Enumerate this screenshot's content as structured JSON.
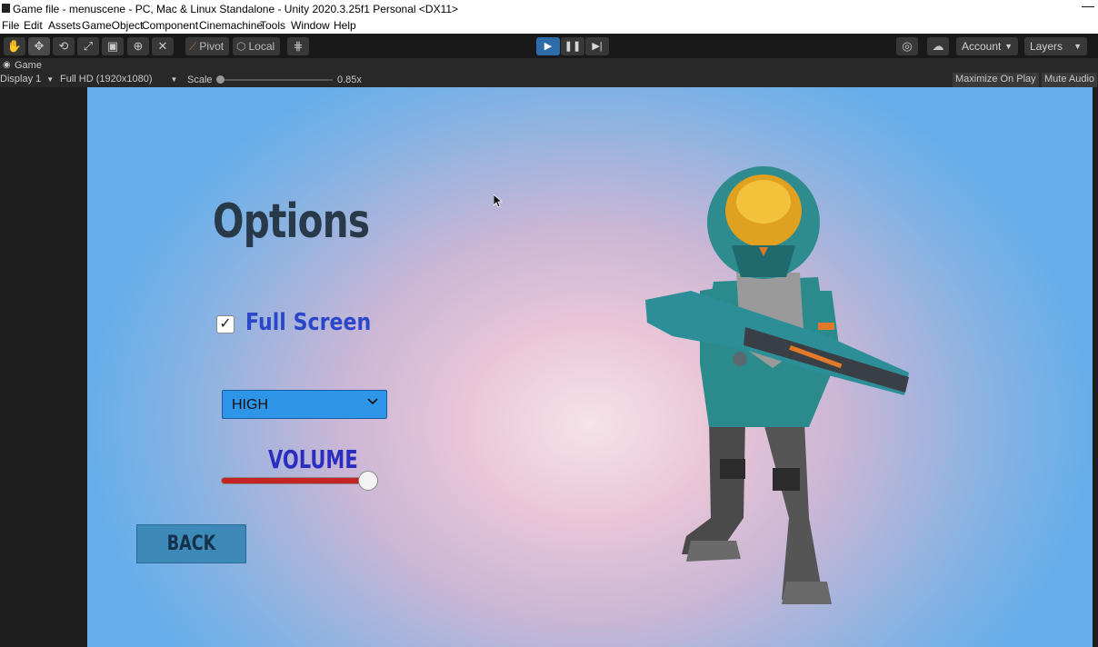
{
  "window": {
    "title": "Game file - menuscene - PC, Mac & Linux Standalone - Unity 2020.3.25f1 Personal <DX11>",
    "minimize_glyph": "—"
  },
  "menu": [
    "File",
    "Edit",
    "Assets",
    "GameObject",
    "Component",
    "Cinemachine",
    "Tools",
    "Window",
    "Help"
  ],
  "toolbar": {
    "pivot_label": "Pivot",
    "local_label": "Local",
    "account_label": "Account",
    "layers_label": "Layers"
  },
  "game_tab": {
    "label": "Game",
    "display": "Display 1",
    "resolution": "Full HD (1920x1080)",
    "scale_label": "Scale",
    "scale_value": "0.85x",
    "maximize_label": "Maximize On Play",
    "mute_label": "Mute Audio"
  },
  "game_ui": {
    "title": "Options",
    "fullscreen_label": "Full Screen",
    "fullscreen_checked": true,
    "quality_value": "HIGH",
    "volume_label": "VOLUME",
    "volume_level": 0.95,
    "back_label": "BACK"
  },
  "colors": {
    "play_active": "#2d6ca8",
    "dropdown": "#2e96e8",
    "slider_fill": "#c42424",
    "back_button": "#3d8ab8",
    "fullscreen_text": "#2b47c9"
  }
}
